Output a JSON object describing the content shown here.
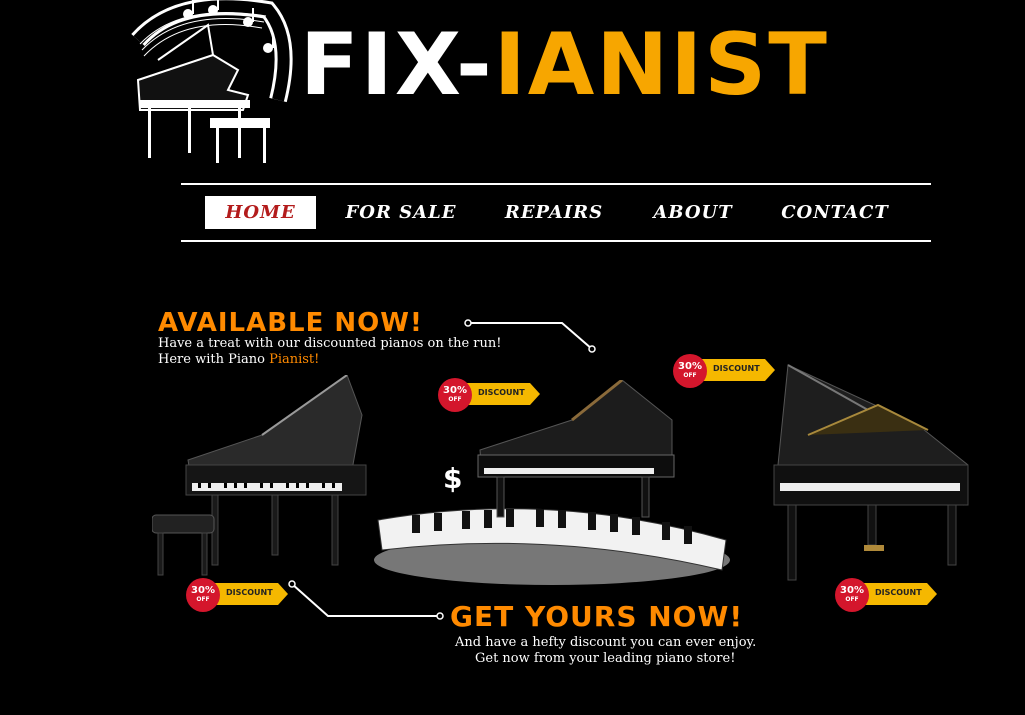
{
  "brand": {
    "part1": "FIX-",
    "part2": "IANIST",
    "white": "#ffffff",
    "yellow": "#f7a600"
  },
  "nav": {
    "items": [
      {
        "label": "HOME",
        "active": true
      },
      {
        "label": "FOR SALE",
        "active": false
      },
      {
        "label": "REPAIRS",
        "active": false
      },
      {
        "label": "ABOUT",
        "active": false
      },
      {
        "label": "CONTACT",
        "active": false
      }
    ]
  },
  "promo_top": {
    "headline": "AVAILABLE NOW!",
    "line1": "Have a treat with our discounted pianos on the run!",
    "line2_prefix": "Here with Piano ",
    "line2_highlight": "Pianist!"
  },
  "promo_bottom": {
    "headline": "GET YOURS NOW!",
    "line1": "And have a hefty discount you can ever enjoy.",
    "line2": "Get now from your leading piano store!"
  },
  "badge": {
    "percent": "30%",
    "off": "OFF",
    "label": "DISCOUNT"
  },
  "dollar_sign": "$",
  "colors": {
    "accent_orange": "#ff8a00",
    "nav_active_text": "#b31b1b",
    "badge_red": "#d4162c",
    "badge_yellow": "#f5b800"
  },
  "icons": [
    "piano-logo-icon",
    "grand-piano-image",
    "piano-keys-image",
    "dollar-icon"
  ]
}
